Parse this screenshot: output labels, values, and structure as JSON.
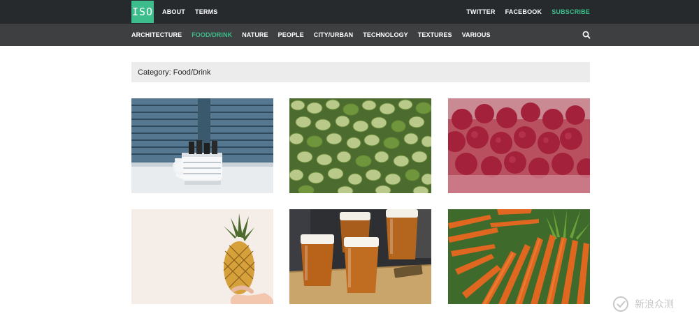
{
  "brand": {
    "logo_text": "ISO"
  },
  "top_nav": {
    "about": "ABOUT",
    "terms": "TERMS"
  },
  "social_nav": {
    "twitter": "TWITTER",
    "facebook": "FACEBOOK",
    "subscribe": "SUBSCRIBE"
  },
  "category_nav": {
    "items": [
      "ARCHITECTURE",
      "FOOD/DRINK",
      "NATURE",
      "PEOPLE",
      "CITY/URBAN",
      "TECHNOLOGY",
      "TEXTURES",
      "VARIOUS"
    ],
    "active": "FOOD/DRINK",
    "search_icon": "search-icon"
  },
  "page": {
    "category_title": "Category: Food/Drink"
  },
  "colors": {
    "accent": "#3dbd8b",
    "topbar": "#262a2d",
    "catbar": "#3d3f41"
  },
  "watermark": {
    "text": "新浪众测"
  }
}
